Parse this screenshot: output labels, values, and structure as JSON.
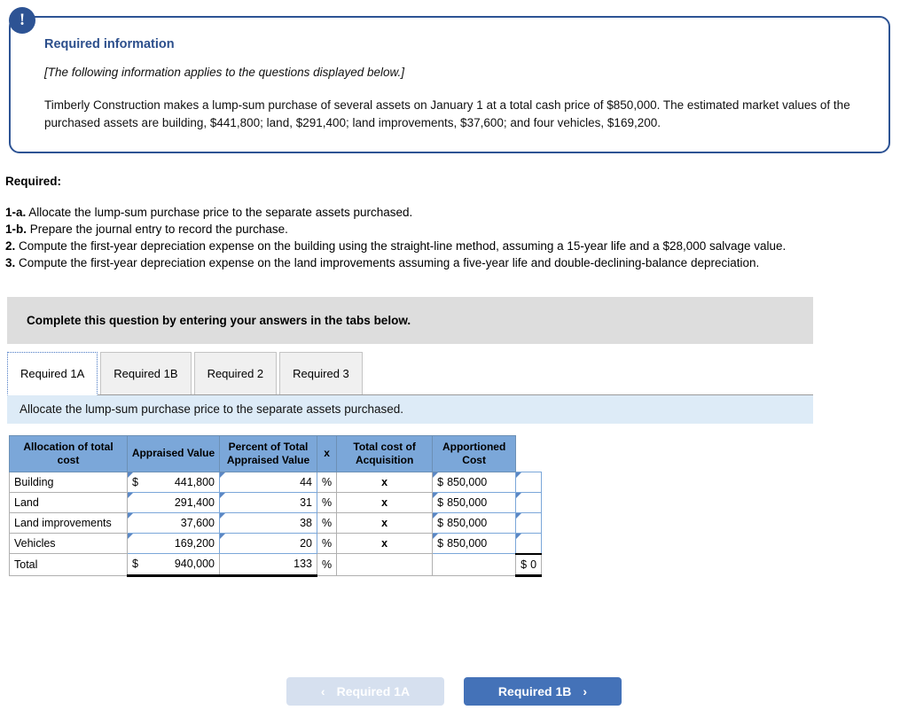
{
  "callout": {
    "badge_icon": "exclamation-icon",
    "title": "Required information",
    "italic_note": "[The following information applies to the questions displayed below.]",
    "body": "Timberly Construction makes a lump-sum purchase of several assets on January 1 at a total cash price of $850,000. The estimated market values of the purchased assets are building, $441,800; land, $291,400; land improvements, $37,600; and four vehicles, $169,200.",
    "border_color": "#2d5394",
    "title_color": "#2c4f8c"
  },
  "required": {
    "label": "Required:",
    "items": [
      {
        "num": "1-a.",
        "text": " Allocate the lump-sum purchase price to the separate assets purchased."
      },
      {
        "num": "1-b.",
        "text": " Prepare the journal entry to record the purchase."
      },
      {
        "num": "2.",
        "text": " Compute the first-year depreciation expense on the building using the straight-line method, assuming a 15-year life and a $28,000 salvage value."
      },
      {
        "num": "3.",
        "text": " Compute the first-year depreciation expense on the land improvements assuming a five-year life and double-declining-balance depreciation."
      }
    ]
  },
  "banner": {
    "text": "Complete this question by entering your answers in the tabs below.",
    "background": "#dddddd"
  },
  "tabs": {
    "items": [
      {
        "label": "Required 1A",
        "active": true
      },
      {
        "label": "Required 1B",
        "active": false
      },
      {
        "label": "Required 2",
        "active": false
      },
      {
        "label": "Required 3",
        "active": false
      }
    ]
  },
  "sub_instruction": {
    "text": "Allocate the lump-sum purchase price to the separate assets purchased.",
    "background": "#ddebf7"
  },
  "table": {
    "header_background": "#7ba7d9",
    "headers": [
      "Allocation of total cost",
      "Appraised Value",
      "Percent of Total Appraised Value",
      "x",
      "Total cost of Acquisition",
      "Apportioned Cost"
    ],
    "rows": [
      {
        "label": "Building",
        "appraised_dollar": "$",
        "appraised_value": "441,800",
        "percent": "44",
        "percent_symbol": "%",
        "x": "x",
        "total_cost_dollar": "$",
        "total_cost": "850,000",
        "apportioned": ""
      },
      {
        "label": "Land",
        "appraised_dollar": "",
        "appraised_value": "291,400",
        "percent": "31",
        "percent_symbol": "%",
        "x": "x",
        "total_cost_dollar": "$",
        "total_cost": "850,000",
        "apportioned": ""
      },
      {
        "label": "Land improvements",
        "appraised_dollar": "",
        "appraised_value": "37,600",
        "percent": "38",
        "percent_symbol": "%",
        "x": "x",
        "total_cost_dollar": "$",
        "total_cost": "850,000",
        "apportioned": ""
      },
      {
        "label": "Vehicles",
        "appraised_dollar": "",
        "appraised_value": "169,200",
        "percent": "20",
        "percent_symbol": "%",
        "x": "x",
        "total_cost_dollar": "$",
        "total_cost": "850,000",
        "apportioned": ""
      }
    ],
    "total_row": {
      "label": "Total",
      "appraised_dollar": "$",
      "appraised_value": "940,000",
      "percent": "133",
      "percent_symbol": "%",
      "x": "",
      "total_cost_dollar": "",
      "total_cost": "",
      "apportioned_dollar": "$",
      "apportioned": "0"
    }
  },
  "footer": {
    "prev_label": "Required 1A",
    "prev_chevron": "‹",
    "next_label": "Required 1B",
    "next_chevron": "›",
    "prev_background": "#d6e0ef",
    "next_background": "#4472b8"
  }
}
